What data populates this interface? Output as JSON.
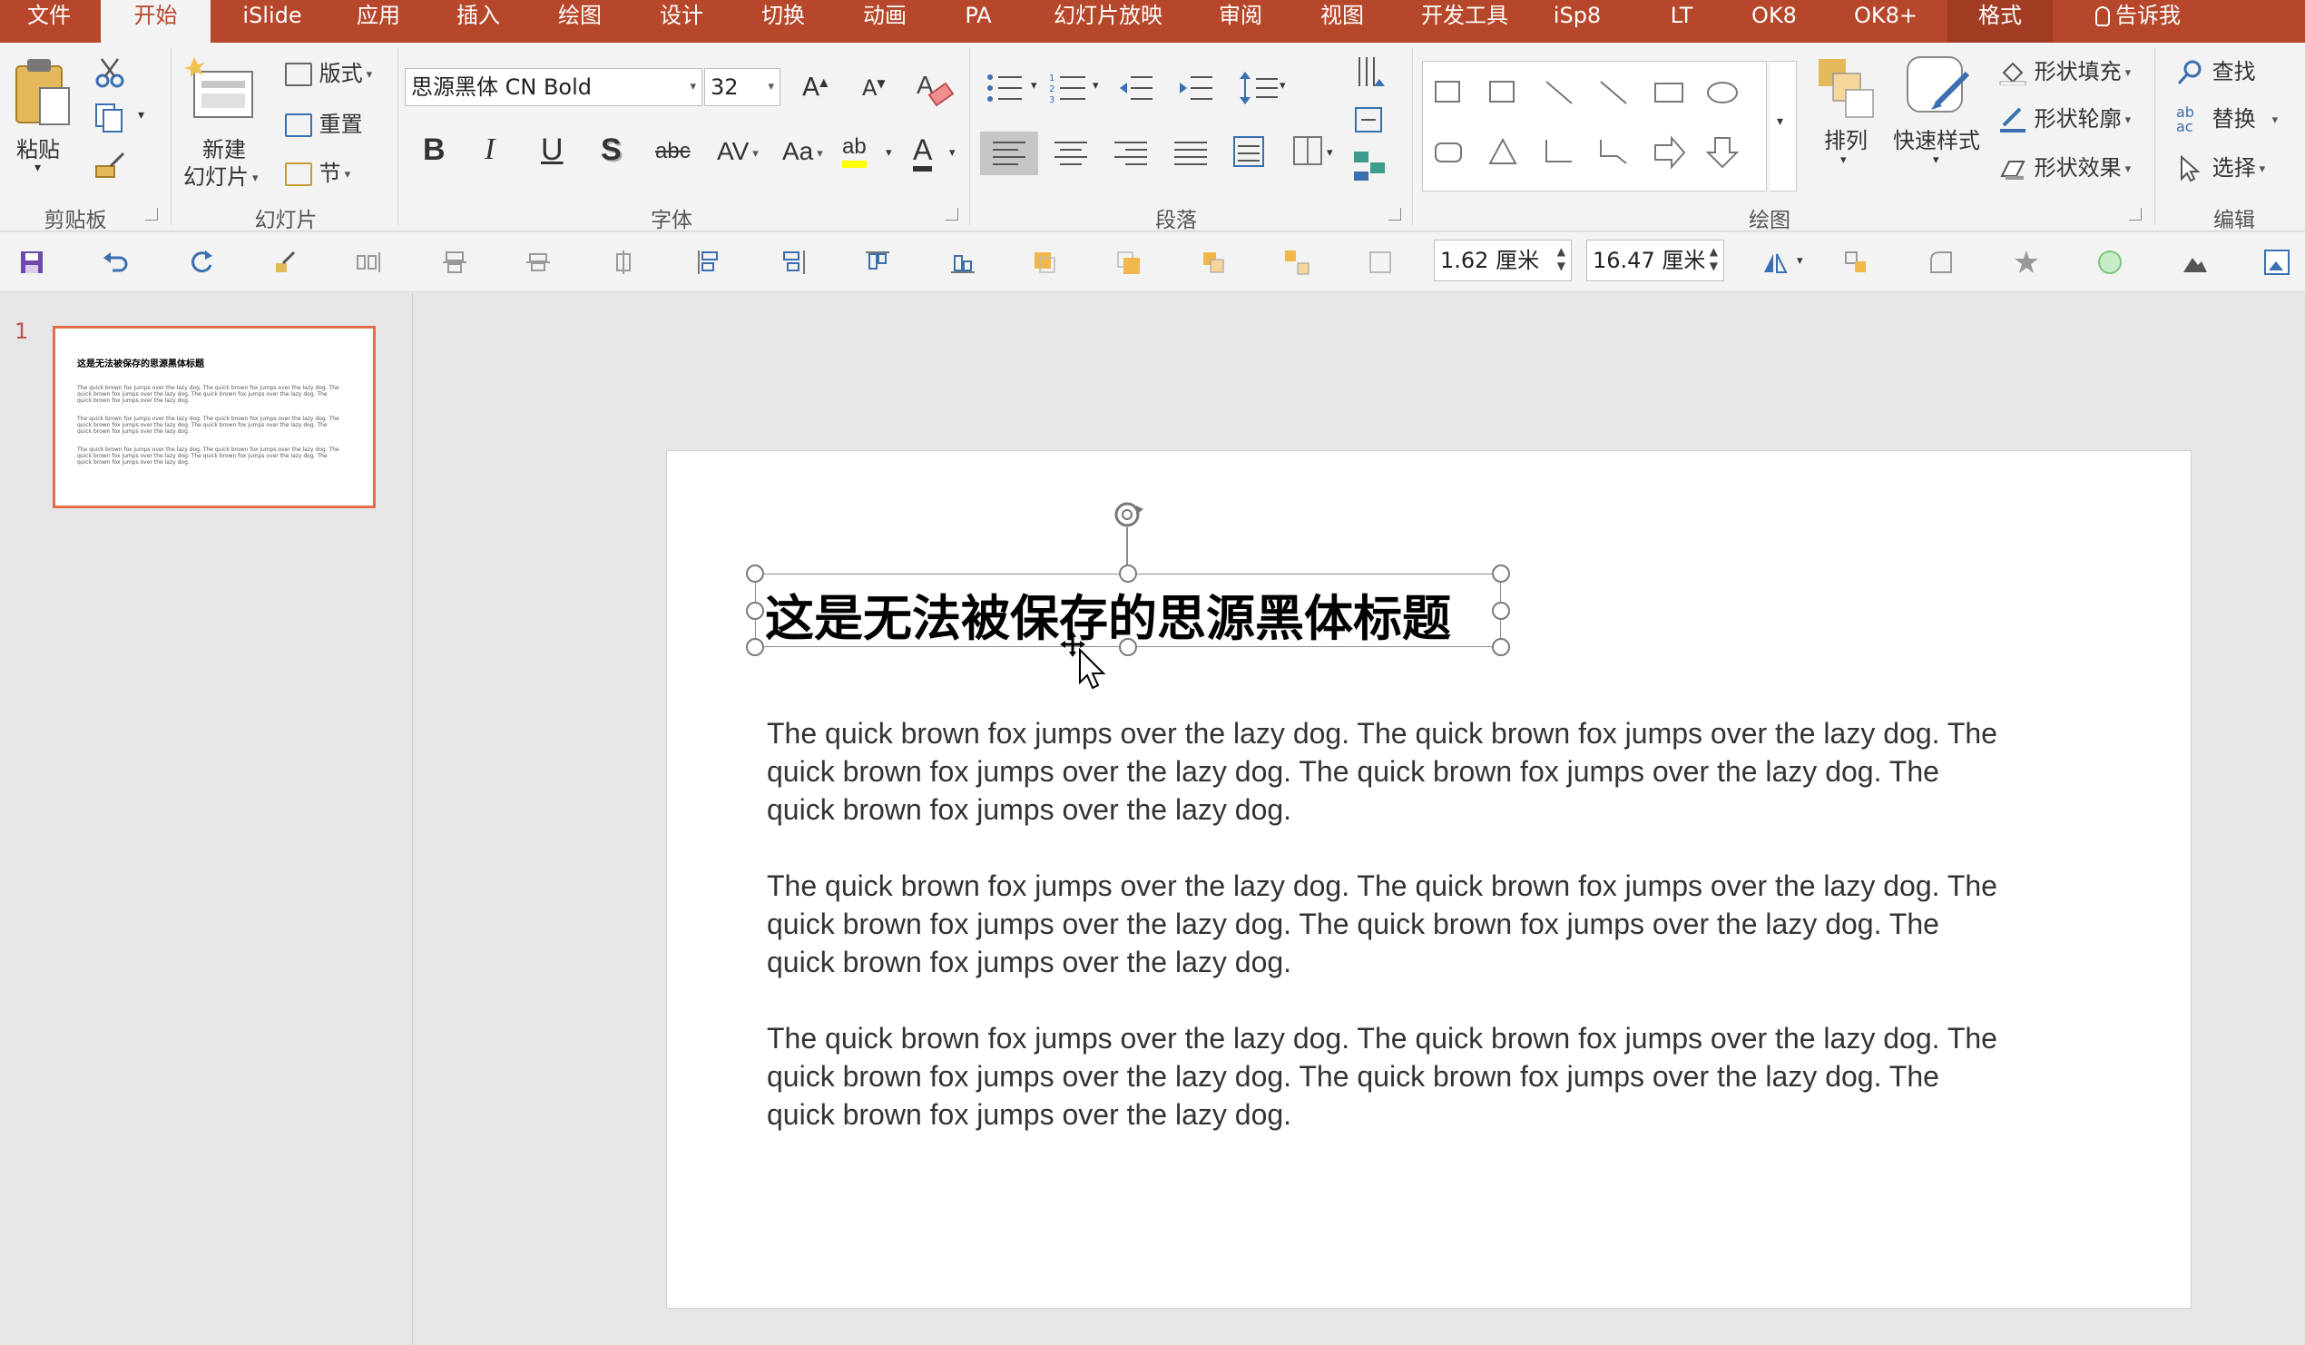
{
  "tabs": [
    "文件",
    "开始",
    "iSlide",
    "应用",
    "插入",
    "绘图",
    "设计",
    "切换",
    "动画",
    "PA",
    "幻灯片放映",
    "审阅",
    "视图",
    "开发工具",
    "iSp8",
    "LT",
    "OK8",
    "OK8+",
    "格式",
    "告诉我"
  ],
  "active_tab": "开始",
  "ribbon": {
    "clipboard": {
      "paste": "粘贴",
      "label": "剪贴板"
    },
    "slides": {
      "new_slide_1": "新建",
      "new_slide_2": "幻灯片",
      "layout": "版式",
      "reset": "重置",
      "section": "节",
      "label": "幻灯片"
    },
    "font": {
      "name": "思源黑体 CN Bold",
      "size": "32",
      "label": "字体"
    },
    "paragraph": {
      "label": "段落"
    },
    "drawing": {
      "arrange": "排列",
      "quick_styles": "快速样式",
      "shape_fill": "形状填充",
      "shape_outline": "形状轮廓",
      "shape_effects": "形状效果",
      "label": "绘图"
    },
    "editing": {
      "find": "查找",
      "replace": "替换",
      "select": "选择",
      "label": "编辑"
    }
  },
  "qat": {
    "height_value": "1.62 厘米",
    "width_value": "16.47 厘米"
  },
  "thumbnail": {
    "number": "1"
  },
  "slide": {
    "title": "这是无法被保存的思源黑体标题",
    "paragraphs": [
      [
        "The quick brown fox jumps over the lazy dog. The quick brown fox jumps over the lazy dog. The",
        "quick brown fox jumps over the lazy dog. The quick brown fox jumps over the lazy dog. The",
        "quick brown fox jumps over the lazy dog."
      ],
      [
        "The quick brown fox jumps over the lazy dog. The quick brown fox jumps over the lazy dog. The",
        "quick brown fox jumps over the lazy dog. The quick brown fox jumps over the lazy dog. The",
        "quick brown fox jumps over the lazy dog."
      ],
      [
        "The quick brown fox jumps over the lazy dog. The quick brown fox jumps over the lazy dog. The",
        "quick brown fox jumps over the lazy dog. The quick brown fox jumps over the lazy dog. The",
        "quick brown fox jumps over the lazy dog."
      ]
    ]
  },
  "colors": {
    "accent": "#b7472a",
    "ribbon_bg": "#f3f3f3",
    "thumb_border": "#e46c48"
  }
}
